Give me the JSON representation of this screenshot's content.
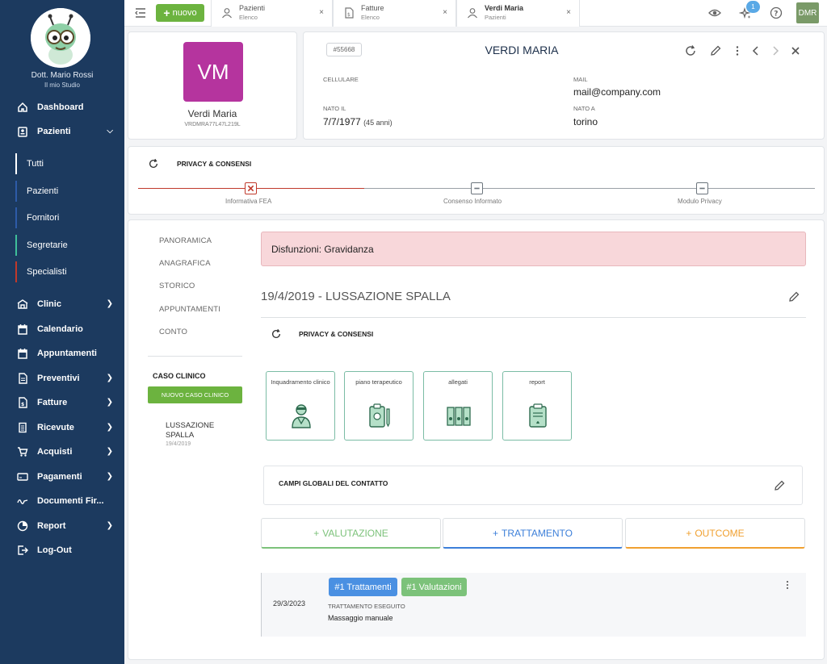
{
  "sidebar": {
    "user_name": "Dott. Mario Rossi",
    "studio_name": "Il mio Studio",
    "nav": [
      {
        "label": "Dashboard",
        "icon": "home-icon"
      },
      {
        "label": "Pazienti",
        "icon": "patients-icon"
      },
      {
        "label": "Clinic",
        "icon": "clinic-icon"
      },
      {
        "label": "Calendario",
        "icon": "calendar-icon"
      },
      {
        "label": "Appuntamenti",
        "icon": "appointments-icon"
      },
      {
        "label": "Preventivi",
        "icon": "estimate-icon"
      },
      {
        "label": "Fatture",
        "icon": "invoice-icon"
      },
      {
        "label": "Ricevute",
        "icon": "receipt-icon"
      },
      {
        "label": "Acquisti",
        "icon": "cart-icon"
      },
      {
        "label": "Pagamenti",
        "icon": "payment-icon"
      },
      {
        "label": "Documenti Fir...",
        "icon": "signature-icon"
      },
      {
        "label": "Report",
        "icon": "report-icon"
      },
      {
        "label": "Log-Out",
        "icon": "logout-icon"
      }
    ],
    "sub": [
      {
        "label": "Tutti",
        "color": "#ffffff"
      },
      {
        "label": "Pazienti",
        "color": "#2d5ba8"
      },
      {
        "label": "Fornitori",
        "color": "#2d5ba8"
      },
      {
        "label": "Segretarie",
        "color": "#3fbf9a"
      },
      {
        "label": "Specialisti",
        "color": "#c0392b"
      }
    ]
  },
  "topbar": {
    "new_label": "nuovo",
    "tabs": [
      {
        "title": "Pazienti",
        "sub": "Elenco",
        "icon": "user-icon"
      },
      {
        "title": "Fatture",
        "sub": "Elenco",
        "icon": "invoice-icon"
      },
      {
        "title": "Verdi Maria",
        "sub": "Pazienti",
        "icon": "user-icon"
      }
    ],
    "close_glyph": "×",
    "notif_count": "1",
    "user_initials": "DMR"
  },
  "patient": {
    "initials": "VM",
    "name": "Verdi Maria",
    "cf": "VRDMRA77L47L219L",
    "id": "#55668",
    "title": "VERDI MARIA",
    "cellulare_label": "CELLULARE",
    "mail_label": "MAIL",
    "mail": "mail@company.com",
    "nato_il_label": "NATO IL",
    "nato_il": "7/7/1977",
    "age": "(45 anni)",
    "nato_a_label": "NATO A",
    "nato_a": "torino"
  },
  "privacy": {
    "title": "PRIVACY & CONSENSI",
    "steps": [
      "Informativa FEA",
      "Consenso Informato",
      "Modulo Privacy"
    ]
  },
  "detail": {
    "menu": [
      "PANORAMICA",
      "ANAGRAFICA",
      "STORICO",
      "APPUNTAMENTI",
      "CONTO"
    ],
    "case_label": "CASO CLINICO",
    "new_case": "NUOVO CASO CLINICO",
    "case_item_title": "LUSSAZIONE SPALLA",
    "case_item_date": "19/4/2019",
    "alert": "Disfunzioni: Gravidanza",
    "case_title": "19/4/2019 - LUSSAZIONE SPALLA",
    "privacy_title": "PRIVACY & CONSENSI",
    "tiles": [
      {
        "label": "Inquadramento clinico",
        "icon": "doctor-icon"
      },
      {
        "label": "piano terapeutico",
        "icon": "therapy-plan-icon"
      },
      {
        "label": "allegati",
        "icon": "attachments-icon"
      },
      {
        "label": "report",
        "icon": "report-clipboard-icon"
      }
    ],
    "global_fields": "CAMPI GLOBALI DEL CONTATTO",
    "actions": [
      {
        "label": "VALUTAZIONE",
        "color": "#7cc27a"
      },
      {
        "label": "TRATTAMENTO",
        "color": "#3c7fd9"
      },
      {
        "label": "OUTCOME",
        "color": "#f0a030"
      }
    ],
    "plus": "+",
    "entry": {
      "date": "29/3/2023",
      "pill_trattamenti": "#1 Trattamenti",
      "pill_valutazioni": "#1 Valutazioni",
      "type": "TRATTAMENTO ESEGUITO",
      "desc": "Massaggio manuale"
    }
  }
}
